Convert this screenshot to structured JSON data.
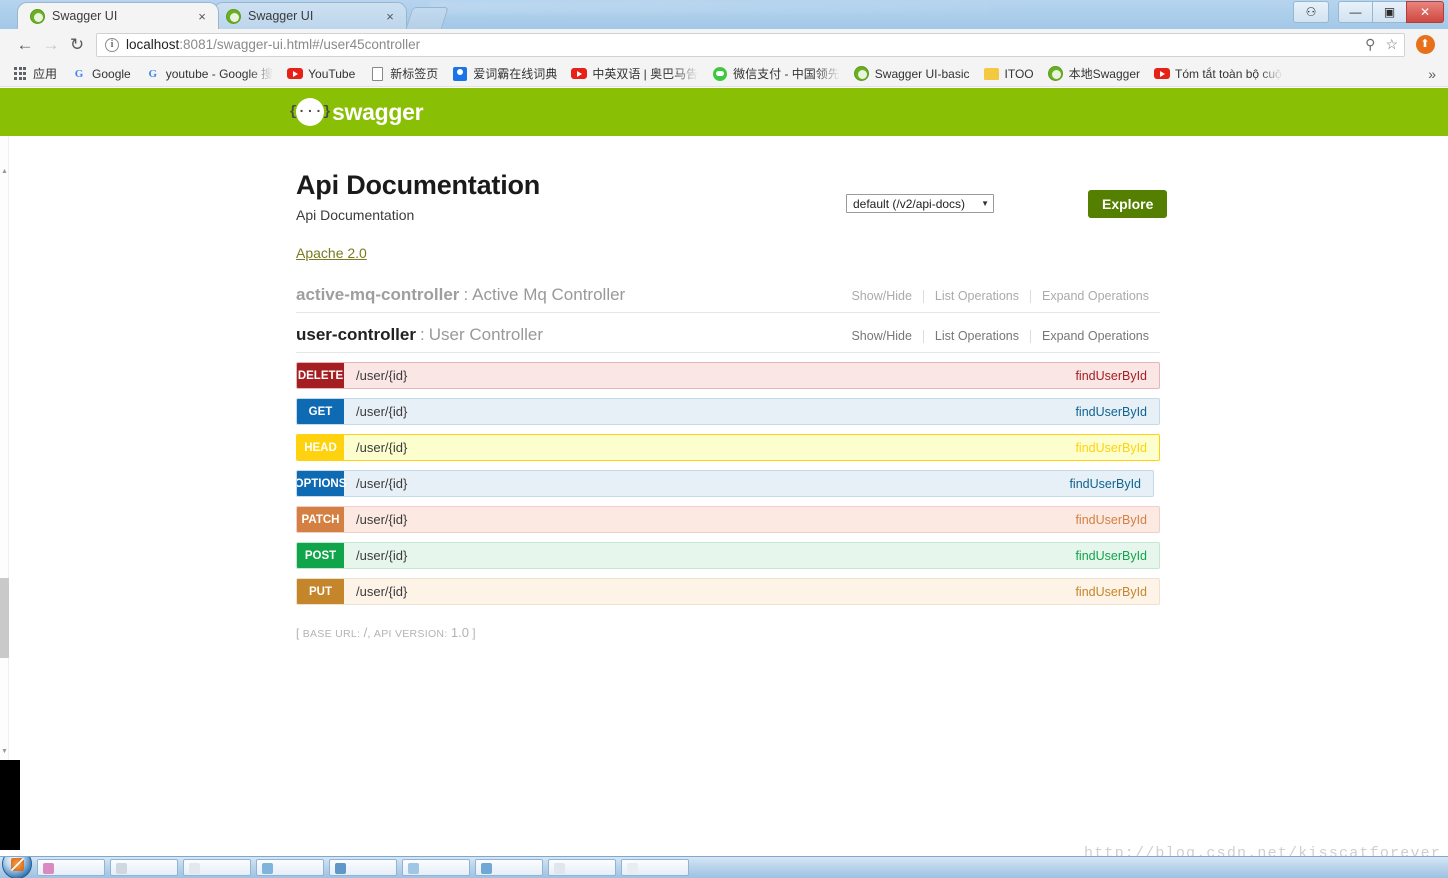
{
  "browser": {
    "tabs": [
      {
        "title": "Swagger UI",
        "active": true,
        "close_label": "×"
      },
      {
        "title": "Swagger UI",
        "active": false,
        "close_label": "×"
      }
    ],
    "window_controls": {
      "person": "⚇",
      "minimize": "—",
      "maximize": "▣",
      "close": "✕"
    },
    "nav": {
      "back": "←",
      "forward": "→",
      "reload": "↻"
    },
    "omnibox": {
      "info_glyph": "i",
      "url_host": "localhost",
      "url_rest": ":8081/swagger-ui.html#/user45controller",
      "search_glyph": "⚲",
      "star_glyph": "☆"
    },
    "menu_glyph": "⬆",
    "bookmarks": [
      {
        "label": "应用",
        "icon": "apps-grid-icon"
      },
      {
        "label": "Google",
        "icon": "google-icon"
      },
      {
        "label": "youtube - Google 搜",
        "icon": "google-icon"
      },
      {
        "label": "YouTube",
        "icon": "youtube-icon"
      },
      {
        "label": "新标签页",
        "icon": "page-icon"
      },
      {
        "label": "爱词霸在线词典",
        "icon": "iciba-icon"
      },
      {
        "label": "中英双语 | 奥巴马告",
        "icon": "youtube-icon"
      },
      {
        "label": "微信支付 - 中国领先",
        "icon": "wechat-icon"
      },
      {
        "label": "Swagger UI-basic",
        "icon": "swagger-icon"
      },
      {
        "label": "ITOO",
        "icon": "folder-icon"
      },
      {
        "label": "本地Swagger",
        "icon": "swagger-icon"
      },
      {
        "label": "Tóm tắt toàn bộ cuộc",
        "icon": "youtube-icon"
      }
    ],
    "bookmarks_overflow": "»"
  },
  "swagger": {
    "brand": "swagger",
    "logo_glyph": "{···}",
    "api_select_value": "default (/v2/api-docs)",
    "api_select_caret": "▼",
    "explore_label": "Explore",
    "title": "Api Documentation",
    "subtitle": "Api Documentation",
    "license": "Apache 2.0",
    "ops_actions": {
      "show_hide": "Show/Hide",
      "list_operations": "List Operations",
      "expand_operations": "Expand Operations"
    },
    "resources": [
      {
        "name": "active-mq-controller",
        "separator": " : ",
        "description": "Active Mq Controller",
        "active": false
      },
      {
        "name": "user-controller",
        "separator": " : ",
        "description": "User Controller",
        "active": true
      }
    ],
    "operations": [
      {
        "method": "DELETE",
        "path": "/user/{id}",
        "summary": "findUserById",
        "badge_bg": "#a41e22",
        "row_bg": "#fbe6e6",
        "row_border": "#e8b4b6",
        "text": "#a41e22"
      },
      {
        "method": "GET",
        "path": "/user/{id}",
        "summary": "findUserById",
        "badge_bg": "#0f6ab4",
        "row_bg": "#e7f0f7",
        "row_border": "#c3d9ec",
        "text": "#10638f"
      },
      {
        "method": "HEAD",
        "path": "/user/{id}",
        "summary": "findUserById",
        "badge_bg": "#ffd20f",
        "row_bg": "#fcffcd",
        "row_border": "#ffd20f",
        "text": "#ffd20f"
      },
      {
        "method": "OPTIONS",
        "path": "/user/{id}",
        "summary": "findUserById",
        "badge_bg": "#0f6ab4",
        "row_bg": "#e7f0f7",
        "row_border": "#c3d9ec",
        "text": "#10638f"
      },
      {
        "method": "PATCH",
        "path": "/user/{id}",
        "summary": "findUserById",
        "badge_bg": "#d38042",
        "row_bg": "#fce9e1",
        "row_border": "#f0cecb",
        "text": "#d38042"
      },
      {
        "method": "POST",
        "path": "/user/{id}",
        "summary": "findUserById",
        "badge_bg": "#10a54a",
        "row_bg": "#e7f6ec",
        "row_border": "#c3e8d1",
        "text": "#10a54a"
      },
      {
        "method": "PUT",
        "path": "/user/{id}",
        "summary": "findUserById",
        "badge_bg": "#c5862b",
        "row_bg": "#fdf3e7",
        "row_border": "#f0e0ce",
        "text": "#c5862b"
      }
    ],
    "footer": {
      "open": "[",
      "base_url_label": "BASE URL:",
      "base_url_value": "/",
      "comma": ",",
      "api_version_label": "API VERSION:",
      "api_version_value": "1.0",
      "close": "]"
    }
  },
  "watermark": "http://blog.csdn.net/kisscatforever",
  "colors": {
    "swagger_green": "#89bf04",
    "explore_green": "#547f00",
    "link": "#7a7a1f"
  }
}
